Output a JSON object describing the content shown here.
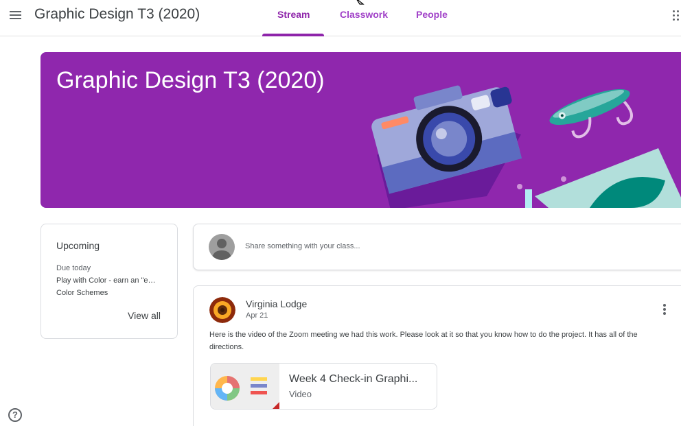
{
  "header": {
    "title": "Graphic Design T3 (2020)",
    "tabs": [
      {
        "label": "Stream",
        "active": true
      },
      {
        "label": "Classwork",
        "active": false
      },
      {
        "label": "People",
        "active": false
      }
    ],
    "menu_icon": "hamburger-menu-icon",
    "apps_icon": "apps-grid-icon"
  },
  "banner": {
    "title": "Graphic Design T3 (2020)",
    "color": "#8f27ad",
    "art": "camera-fishing-lure-illustration"
  },
  "upcoming": {
    "title": "Upcoming",
    "due_label": "Due today",
    "items": [
      "Play with Color - earn an \"e…",
      "Color Schemes"
    ],
    "view_all": "View all"
  },
  "share": {
    "placeholder": "Share something with your class..."
  },
  "post": {
    "author": "Virginia Lodge",
    "date": "Apr 21",
    "body": "Here is the video of the Zoom meeting we had this work. Please look at it so that you know how to do the project. It has all of the directions.",
    "attachment": {
      "title": "Week 4 Check-in Graphi...",
      "type": "Video"
    }
  },
  "help_icon": "help-circle-icon",
  "colors": {
    "accent": "#8e24aa",
    "tab_text": "#a142c8"
  }
}
